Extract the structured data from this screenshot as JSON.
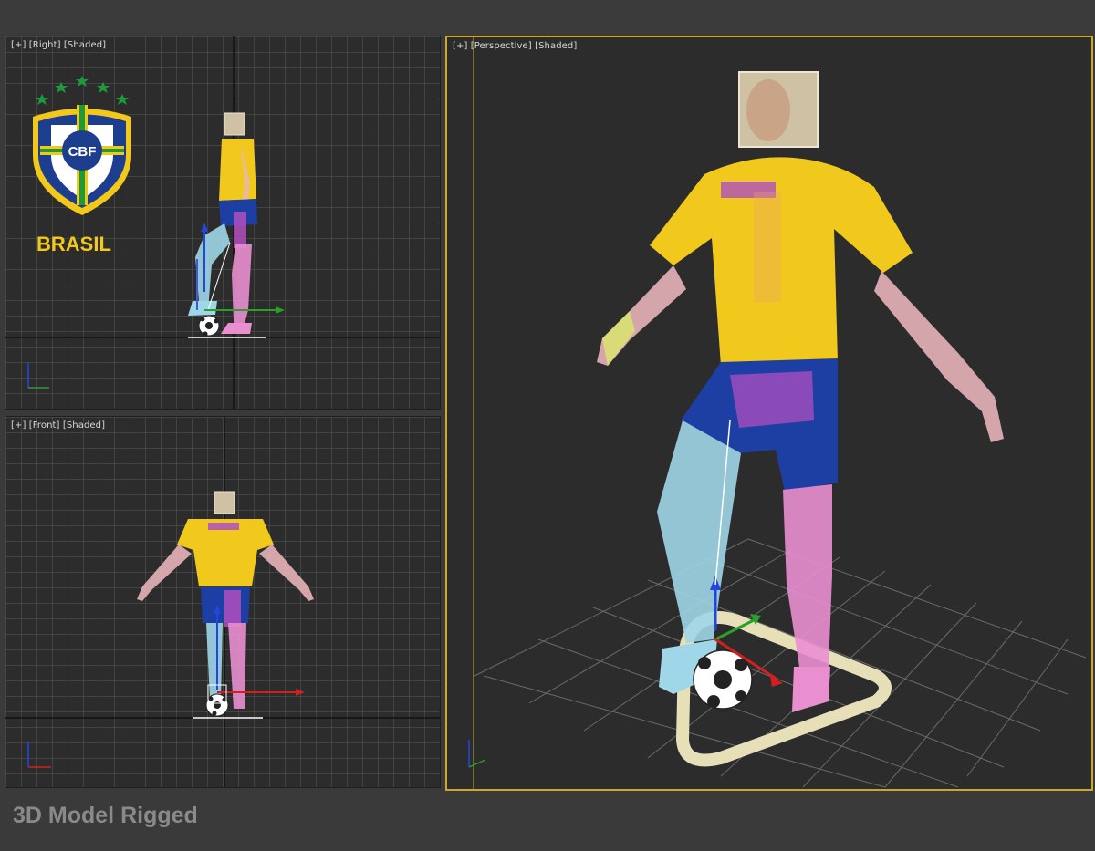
{
  "viewports": {
    "right": {
      "plus": "[+]",
      "view": "[Right]",
      "mode": "[Shaded]"
    },
    "front": {
      "plus": "[+]",
      "view": "[Front]",
      "mode": "[Shaded]"
    },
    "persp": {
      "plus": "[+]",
      "view": "[Perspective]",
      "mode": "[Shaded]"
    }
  },
  "logo": {
    "badge_text": "CBF",
    "country": "BRASIL",
    "star_color": "#1e9a3a",
    "shield_blue": "#1d3d8f",
    "shield_yellow": "#f2c81a"
  },
  "caption": "3D Model Rigged",
  "gizmo_axes": {
    "x": "x",
    "y": "y",
    "z": "z"
  },
  "colors": {
    "active_border": "#c9a82c",
    "grid": "#5a5a5a",
    "jersey": "#f1c91c",
    "shorts": "#1d3fa3",
    "bone_pink": "#e07ad8",
    "bone_cyan": "#8fd6e6"
  }
}
